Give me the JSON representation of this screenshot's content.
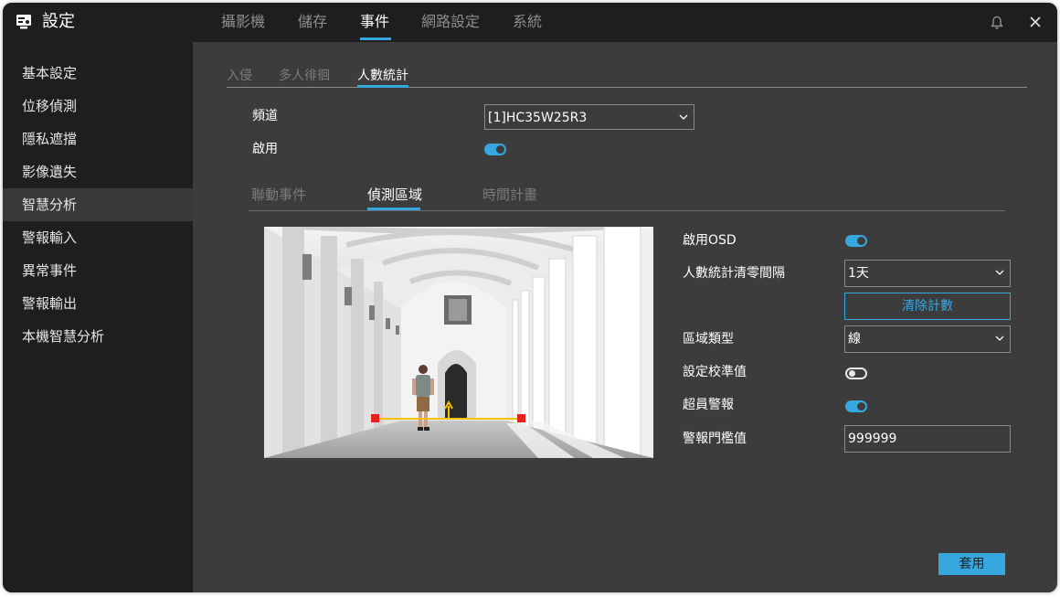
{
  "app": {
    "title": "設定",
    "icon": "settings-display-icon"
  },
  "top_tabs": [
    {
      "label": "攝影機"
    },
    {
      "label": "儲存"
    },
    {
      "label": "事件",
      "active": true
    },
    {
      "label": "網路設定"
    },
    {
      "label": "系統"
    }
  ],
  "window_controls": {
    "notify_icon": "bell-icon",
    "close_icon": "close-icon"
  },
  "sidebar": {
    "items": [
      {
        "label": "基本設定"
      },
      {
        "label": "位移偵測"
      },
      {
        "label": "隱私遮擋"
      },
      {
        "label": "影像遺失"
      },
      {
        "label": "智慧分析",
        "active": true
      },
      {
        "label": "警報輸入"
      },
      {
        "label": "異常事件"
      },
      {
        "label": "警報輸出"
      },
      {
        "label": "本機智慧分析"
      }
    ]
  },
  "sub_tabs": [
    {
      "label": "入侵"
    },
    {
      "label": "多人徘徊"
    },
    {
      "label": "人數統計",
      "active": true
    }
  ],
  "form": {
    "channel": {
      "label": "頻道",
      "value": "[1]HC35W25R3"
    },
    "enable": {
      "label": "啟用",
      "on": true
    }
  },
  "inner_tabs": [
    {
      "label": "聯動事件"
    },
    {
      "label": "偵測區域",
      "active": true
    },
    {
      "label": "時間計畫"
    }
  ],
  "settings": {
    "osd": {
      "label": "啟用OSD",
      "on": true
    },
    "reset_interval": {
      "label": "人數統計清零間隔",
      "value": "1天"
    },
    "clear_button": "清除計數",
    "area_type": {
      "label": "區域類型",
      "value": "線"
    },
    "calibration": {
      "label": "設定校準值",
      "on": false
    },
    "over_alarm": {
      "label": "超員警報",
      "on": true
    },
    "threshold": {
      "label": "警報門檻值",
      "value": "999999"
    }
  },
  "apply_button": "套用",
  "colors": {
    "accent": "#37a7e0",
    "background": "#3c3c3c",
    "sidebar": "#1e1e1e",
    "line": "#f2c200",
    "marker": "#e8201c"
  }
}
